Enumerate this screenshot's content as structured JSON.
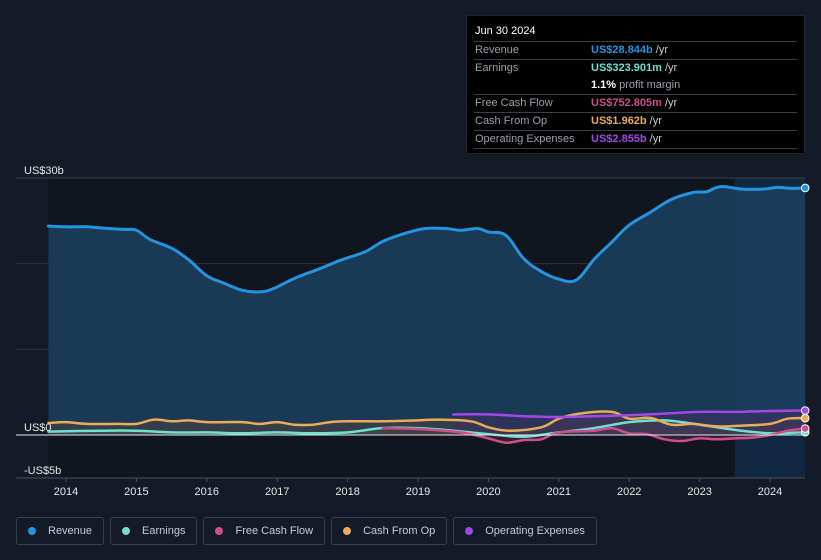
{
  "tooltip": {
    "date": "Jun 30 2024",
    "rows": [
      {
        "label": "Revenue",
        "value": "US$28.844b",
        "unit": "/yr",
        "color": "#2394df"
      },
      {
        "label": "Earnings",
        "value": "US$323.901m",
        "unit": "/yr",
        "color": "#6ee0cd"
      },
      {
        "label": "",
        "value": "1.1%",
        "unit": "profit margin",
        "color": "#ffffff"
      },
      {
        "label": "Free Cash Flow",
        "value": "US$752.805m",
        "unit": "/yr",
        "color": "#cc4f8b"
      },
      {
        "label": "Cash From Op",
        "value": "US$1.962b",
        "unit": "/yr",
        "color": "#e8ac5a"
      },
      {
        "label": "Operating Expenses",
        "value": "US$2.855b",
        "unit": "/yr",
        "color": "#a347e6"
      }
    ]
  },
  "legend": [
    {
      "label": "Revenue",
      "color": "#2394df"
    },
    {
      "label": "Earnings",
      "color": "#6ee0cd"
    },
    {
      "label": "Free Cash Flow",
      "color": "#cc4f8b"
    },
    {
      "label": "Cash From Op",
      "color": "#e8ac5a"
    },
    {
      "label": "Operating Expenses",
      "color": "#a347e6"
    }
  ],
  "chart_data": {
    "type": "area",
    "title": "",
    "xlabel": "",
    "ylabel": "",
    "unit": "US$ billions",
    "ylim": [
      -5,
      30
    ],
    "xlim": [
      2013.5,
      2024.5
    ],
    "y_ticks": [
      {
        "value": 30,
        "label": "US$30b"
      },
      {
        "value": 0,
        "label": "US$0"
      },
      {
        "value": -5,
        "label": "-US$5b"
      }
    ],
    "gridlines": [
      30,
      20,
      10
    ],
    "x_ticks": [
      {
        "value": 2014,
        "label": "2014"
      },
      {
        "value": 2015,
        "label": "2015"
      },
      {
        "value": 2016,
        "label": "2016"
      },
      {
        "value": 2017,
        "label": "2017"
      },
      {
        "value": 2018,
        "label": "2018"
      },
      {
        "value": 2019,
        "label": "2019"
      },
      {
        "value": 2020,
        "label": "2020"
      },
      {
        "value": 2021,
        "label": "2021"
      },
      {
        "value": 2022,
        "label": "2022"
      },
      {
        "value": 2023,
        "label": "2023"
      },
      {
        "value": 2024,
        "label": "2024"
      }
    ],
    "highlight_range": [
      2023.5,
      2024.5
    ],
    "series": [
      {
        "name": "Revenue",
        "color": "#2394df",
        "filled": true,
        "points": [
          [
            2013.75,
            24.4
          ],
          [
            2014.0,
            24.3
          ],
          [
            2014.3,
            24.3
          ],
          [
            2014.6,
            24.1
          ],
          [
            2014.85,
            24.0
          ],
          [
            2015.0,
            23.9
          ],
          [
            2015.2,
            22.8
          ],
          [
            2015.5,
            21.8
          ],
          [
            2015.75,
            20.4
          ],
          [
            2016.0,
            18.6
          ],
          [
            2016.25,
            17.7
          ],
          [
            2016.5,
            16.9
          ],
          [
            2016.75,
            16.7
          ],
          [
            2016.95,
            17.1
          ],
          [
            2017.25,
            18.3
          ],
          [
            2017.6,
            19.4
          ],
          [
            2017.9,
            20.4
          ],
          [
            2018.25,
            21.4
          ],
          [
            2018.5,
            22.6
          ],
          [
            2018.8,
            23.5
          ],
          [
            2019.1,
            24.1
          ],
          [
            2019.4,
            24.1
          ],
          [
            2019.6,
            23.9
          ],
          [
            2019.85,
            24.1
          ],
          [
            2020.0,
            23.7
          ],
          [
            2020.25,
            23.3
          ],
          [
            2020.5,
            20.6
          ],
          [
            2020.75,
            19.1
          ],
          [
            2021.0,
            18.2
          ],
          [
            2021.25,
            18.1
          ],
          [
            2021.5,
            20.5
          ],
          [
            2021.75,
            22.5
          ],
          [
            2022.0,
            24.5
          ],
          [
            2022.3,
            26.0
          ],
          [
            2022.6,
            27.5
          ],
          [
            2022.9,
            28.3
          ],
          [
            2023.1,
            28.4
          ],
          [
            2023.3,
            29.0
          ],
          [
            2023.6,
            28.7
          ],
          [
            2023.9,
            28.7
          ],
          [
            2024.1,
            28.9
          ],
          [
            2024.3,
            28.8
          ],
          [
            2024.5,
            28.844
          ]
        ]
      },
      {
        "name": "Earnings",
        "color": "#6ee0cd",
        "filled": true,
        "points": [
          [
            2013.75,
            0.4
          ],
          [
            2014.5,
            0.5
          ],
          [
            2015.0,
            0.5
          ],
          [
            2015.5,
            0.3
          ],
          [
            2016.0,
            0.3
          ],
          [
            2016.5,
            0.2
          ],
          [
            2017.0,
            0.3
          ],
          [
            2017.5,
            0.2
          ],
          [
            2018.0,
            0.3
          ],
          [
            2018.5,
            0.8
          ],
          [
            2019.0,
            0.8
          ],
          [
            2019.5,
            0.5
          ],
          [
            2020.0,
            0.1
          ],
          [
            2020.5,
            -0.2
          ],
          [
            2021.0,
            0.3
          ],
          [
            2021.5,
            0.8
          ],
          [
            2022.0,
            1.5
          ],
          [
            2022.5,
            1.7
          ],
          [
            2023.0,
            1.2
          ],
          [
            2023.5,
            0.6
          ],
          [
            2024.0,
            0.2
          ],
          [
            2024.5,
            0.324
          ]
        ]
      },
      {
        "name": "Free Cash Flow",
        "color": "#cc4f8b",
        "filled": true,
        "points": [
          [
            2018.5,
            0.8
          ],
          [
            2019.0,
            0.7
          ],
          [
            2019.5,
            0.4
          ],
          [
            2019.75,
            0.1
          ],
          [
            2020.0,
            -0.4
          ],
          [
            2020.25,
            -0.9
          ],
          [
            2020.5,
            -0.6
          ],
          [
            2020.75,
            -0.5
          ],
          [
            2021.0,
            0.3
          ],
          [
            2021.5,
            0.5
          ],
          [
            2021.75,
            0.8
          ],
          [
            2022.0,
            0.2
          ],
          [
            2022.25,
            0.1
          ],
          [
            2022.5,
            -0.5
          ],
          [
            2022.75,
            -0.7
          ],
          [
            2023.0,
            -0.4
          ],
          [
            2023.25,
            -0.5
          ],
          [
            2023.5,
            -0.4
          ],
          [
            2023.75,
            -0.3
          ],
          [
            2024.0,
            0.0
          ],
          [
            2024.25,
            0.5
          ],
          [
            2024.5,
            0.753
          ]
        ]
      },
      {
        "name": "Cash From Op",
        "color": "#e8ac5a",
        "filled": true,
        "points": [
          [
            2013.75,
            1.4
          ],
          [
            2014.0,
            1.5
          ],
          [
            2014.3,
            1.3
          ],
          [
            2014.75,
            1.3
          ],
          [
            2015.0,
            1.3
          ],
          [
            2015.25,
            1.8
          ],
          [
            2015.5,
            1.6
          ],
          [
            2015.75,
            1.7
          ],
          [
            2016.0,
            1.5
          ],
          [
            2016.5,
            1.5
          ],
          [
            2016.75,
            1.3
          ],
          [
            2017.0,
            1.5
          ],
          [
            2017.25,
            1.2
          ],
          [
            2017.5,
            1.2
          ],
          [
            2017.75,
            1.5
          ],
          [
            2018.0,
            1.6
          ],
          [
            2018.5,
            1.6
          ],
          [
            2019.0,
            1.7
          ],
          [
            2019.3,
            1.8
          ],
          [
            2019.75,
            1.6
          ],
          [
            2020.0,
            0.9
          ],
          [
            2020.3,
            0.5
          ],
          [
            2020.75,
            0.9
          ],
          [
            2021.0,
            1.9
          ],
          [
            2021.3,
            2.5
          ],
          [
            2021.75,
            2.7
          ],
          [
            2022.0,
            1.9
          ],
          [
            2022.3,
            2.0
          ],
          [
            2022.6,
            1.2
          ],
          [
            2022.9,
            1.3
          ],
          [
            2023.25,
            1.0
          ],
          [
            2023.6,
            1.1
          ],
          [
            2024.0,
            1.3
          ],
          [
            2024.25,
            1.9
          ],
          [
            2024.5,
            1.962
          ]
        ]
      },
      {
        "name": "Operating Expenses",
        "color": "#a347e6",
        "filled": true,
        "points": [
          [
            2019.5,
            2.4
          ],
          [
            2020.0,
            2.4
          ],
          [
            2020.5,
            2.2
          ],
          [
            2021.0,
            2.1
          ],
          [
            2021.5,
            2.2
          ],
          [
            2022.0,
            2.3
          ],
          [
            2022.5,
            2.5
          ],
          [
            2023.0,
            2.7
          ],
          [
            2023.5,
            2.7
          ],
          [
            2024.0,
            2.8
          ],
          [
            2024.5,
            2.855
          ]
        ]
      }
    ]
  }
}
